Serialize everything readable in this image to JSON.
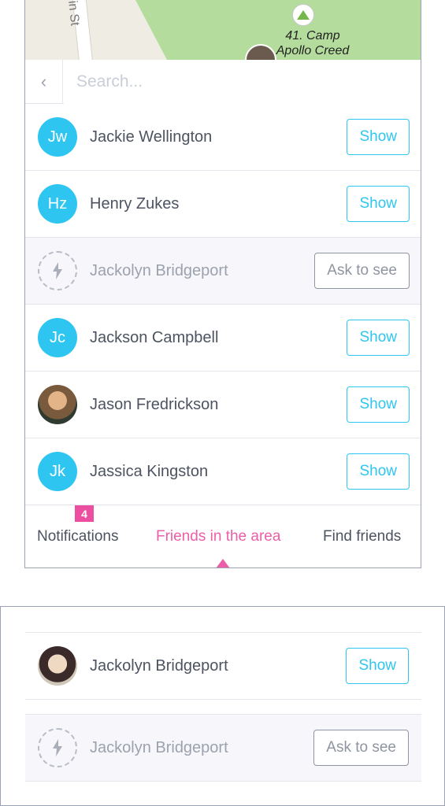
{
  "map": {
    "street_label": "in St",
    "camp_label_line1": "41. Camp",
    "camp_label_line2": "Apollo Creed"
  },
  "search": {
    "back_icon": "chevron-left-icon",
    "placeholder": "Search..."
  },
  "friends": [
    {
      "initials": "Jw",
      "name": "Jackie Wellington",
      "action": "Show",
      "type": "initials"
    },
    {
      "initials": "Hz",
      "name": "Henry Zukes",
      "action": "Show",
      "type": "initials"
    },
    {
      "initials": "",
      "name": "Jackolyn Bridgeport",
      "action": "Ask to see",
      "type": "pending",
      "icon": "lightning-icon"
    },
    {
      "initials": "Jc",
      "name": "Jackson Campbell",
      "action": "Show",
      "type": "initials"
    },
    {
      "initials": "",
      "name": "Jason Fredrickson",
      "action": "Show",
      "type": "photo"
    },
    {
      "initials": "Jk",
      "name": "Jassica Kingston",
      "action": "Show",
      "type": "initials"
    }
  ],
  "tabs": {
    "notifications": "Notifications",
    "notifications_badge": "4",
    "friends_in_area": "Friends in the area",
    "find_friends": "Find friends"
  },
  "variants": [
    {
      "name": "Jackolyn Bridgeport",
      "action": "Show",
      "type": "photo"
    },
    {
      "name": "Jackolyn Bridgeport",
      "action": "Ask to see",
      "type": "pending",
      "icon": "lightning-icon"
    }
  ],
  "colors": {
    "accent_blue": "#2ec6f0",
    "accent_pink": "#ec5fa8",
    "badge_pink": "#ec4fa0",
    "map_green": "#b3dc9d"
  }
}
